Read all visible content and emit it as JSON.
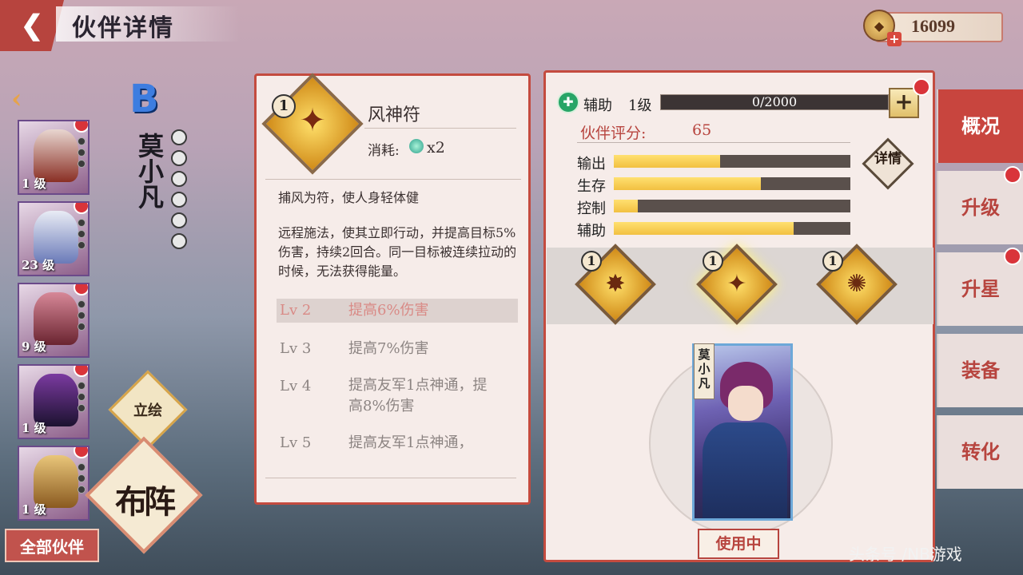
{
  "header": {
    "back_icon": "chevron-left-icon",
    "title": "伙伴详情"
  },
  "currency": {
    "icon": "coin-icon",
    "value": "16099"
  },
  "partner_list": {
    "items": [
      {
        "level": "1 级",
        "colors": [
          "#e8d6d0",
          "#8a2f24"
        ]
      },
      {
        "level": "23 级",
        "colors": [
          "#e9ecf5",
          "#6a7ab8"
        ]
      },
      {
        "level": "9 级",
        "colors": [
          "#d78898",
          "#6a2430"
        ]
      },
      {
        "level": "1 级",
        "colors": [
          "#7b3aa0",
          "#1c1230"
        ]
      },
      {
        "level": "1 级",
        "colors": [
          "#e9c67a",
          "#8a5a20"
        ]
      }
    ],
    "all_button": "全部伙伴"
  },
  "hero": {
    "rank": "B",
    "name": "莫小凡"
  },
  "side_buttons": {
    "lihui": "立绘",
    "buzhen": "布阵"
  },
  "skill": {
    "badge": "1",
    "name": "风神符",
    "cost_label": "消耗:",
    "cost_value": "x2",
    "short_desc": "捕风为符，使人身轻体健",
    "long_desc": "远程施法，使其立即行动，并提高目标5%伤害，持续2回合。同一目标被连续拉动的时候，无法获得能量。",
    "levels": [
      {
        "lv": "Lv 2",
        "text": "提高6%伤害",
        "color": "#d98a86"
      },
      {
        "lv": "Lv 3",
        "text": "提高7%伤害",
        "color": "#8c8482"
      },
      {
        "lv": "Lv 4",
        "text": "提高友军1点神通，提高8%伤害",
        "color": "#8c8482"
      },
      {
        "lv": "Lv 5",
        "text": "提高友军1点神通，",
        "color": "#8c8482"
      }
    ]
  },
  "overview": {
    "role_label": "辅助",
    "level": "1级",
    "exp": "0/2000",
    "exp_fraction": 0,
    "score_label": "伙伴评分:",
    "score_value": "65",
    "attributes": [
      {
        "label": "输出",
        "fraction": 0.45
      },
      {
        "label": "生存",
        "fraction": 0.62
      },
      {
        "label": "控制",
        "fraction": 0.1
      },
      {
        "label": "辅助",
        "fraction": 0.76
      }
    ],
    "detail_label": "详情",
    "skill_badges": [
      "1",
      "1",
      "1"
    ],
    "card_name": "莫小凡",
    "use_button": "使用中"
  },
  "tabs": [
    "概况",
    "升级",
    "升星",
    "装备",
    "转化"
  ],
  "watermark": "头条号 /NB游戏"
}
